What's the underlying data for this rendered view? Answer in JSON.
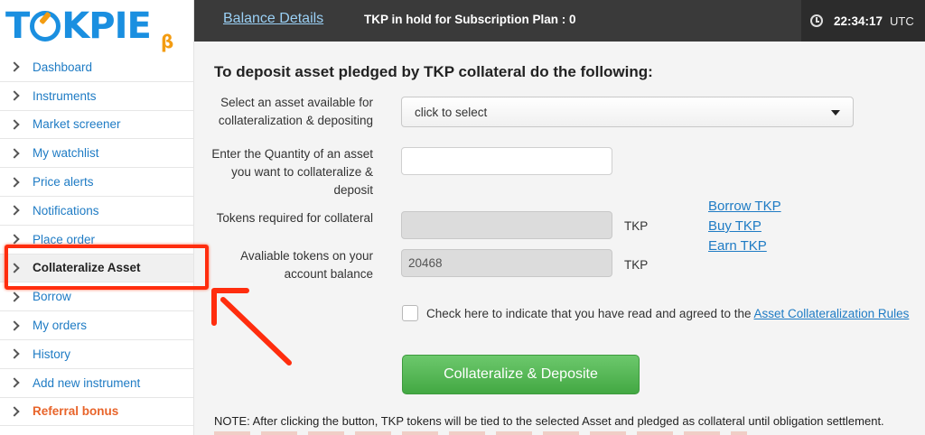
{
  "app": {
    "logo_text": "TOKPIE",
    "logo_badge": "β"
  },
  "sidebar": {
    "items": [
      {
        "label": "Dashboard"
      },
      {
        "label": "Instruments"
      },
      {
        "label": "Market screener"
      },
      {
        "label": "My watchlist"
      },
      {
        "label": "Price alerts"
      },
      {
        "label": "Notifications"
      },
      {
        "label": "Place order"
      },
      {
        "label": "Collateralize Asset",
        "active": true
      },
      {
        "label": "Borrow"
      },
      {
        "label": "My orders"
      },
      {
        "label": "History"
      },
      {
        "label": "Add new instrument"
      },
      {
        "label": "Referral bonus",
        "highlight": true
      }
    ]
  },
  "topbar": {
    "balance_link": "Balance Details",
    "hold_text": "TKP in hold for Subscription Plan : 0",
    "time": "22:34:17",
    "timezone": "UTC"
  },
  "main": {
    "heading": "To deposit asset pledged by TKP collateral do the following:",
    "asset_label": "Select an asset available for collateralization & depositing",
    "asset_select_value": "click to select",
    "quantity_label": "Enter the Quantity of an asset you want to collateralize & deposit",
    "quantity_value": "",
    "tokens_required_label": "Tokens required for collateral",
    "tokens_required_value": "",
    "tokens_required_unit": "TKP",
    "available_label": "Avaliable tokens on your account balance",
    "available_value": "20468",
    "available_unit": "TKP",
    "links": [
      "Borrow TKP",
      "Buy TKP",
      "Earn TKP"
    ],
    "agree_text": "Check here to indicate that you have read and agreed to the",
    "agree_link": "Asset Collateralization Rules",
    "agree_checked": false,
    "submit_label": "Collateralize & Deposite",
    "note": "NOTE: After clicking the button, TKP tokens will be tied to the selected Asset and pledged as collateral until obligation settlement."
  },
  "colors": {
    "accent": "#1e7bc4",
    "topbar_bg": "#3a3a3a",
    "button_green": "#4cae4c",
    "annotation_red": "#ff2d0e",
    "bonus_orange": "#e8642a"
  }
}
